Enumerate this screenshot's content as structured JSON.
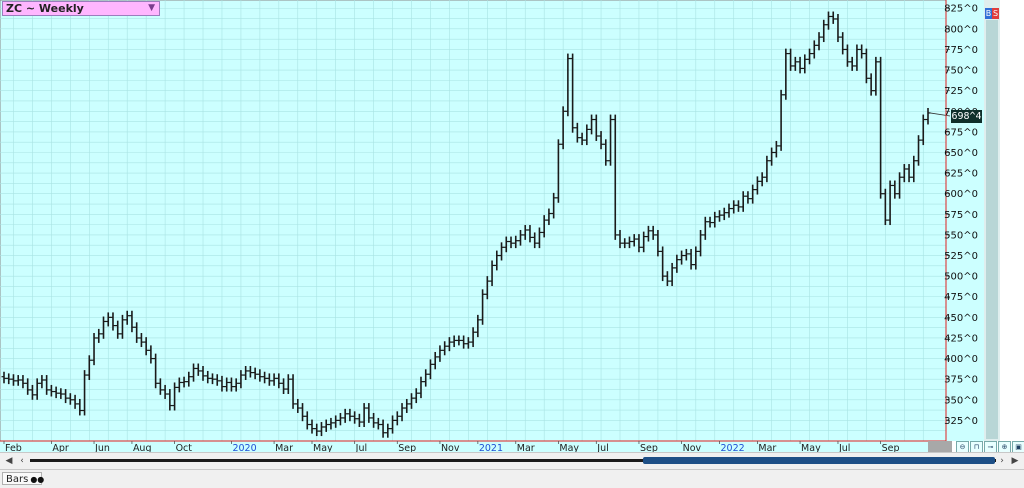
{
  "symbol": {
    "label": "ZC ~ Weekly"
  },
  "side_tags": {
    "buy": "B",
    "sell": "S"
  },
  "last_price_flag": "698^4",
  "status_bar": {
    "tab_label": "Bars"
  },
  "colors": {
    "plot_background": "#ccffff",
    "grid": "#a9e3e3",
    "bars": "#1a1a1a",
    "year_label": "#1f4fd6",
    "axis_line": "#e02020"
  },
  "chart_data": {
    "type": "ohlc",
    "title": "ZC ~ Weekly",
    "ylim": [
      300,
      835
    ],
    "y_ticks": [
      "325^0",
      "350^0",
      "375^0",
      "400^0",
      "425^0",
      "450^0",
      "475^0",
      "500^0",
      "525^0",
      "550^0",
      "575^0",
      "600^0",
      "625^0",
      "650^0",
      "675^0",
      "700^0",
      "725^0",
      "750^0",
      "775^0",
      "800^0",
      "825^0"
    ],
    "y_tick_values": [
      325,
      350,
      375,
      400,
      425,
      450,
      475,
      500,
      525,
      550,
      575,
      600,
      625,
      650,
      675,
      700,
      725,
      750,
      775,
      800,
      825
    ],
    "x_labels": [
      {
        "text": "Feb",
        "week": 0,
        "year": false
      },
      {
        "text": "Apr",
        "week": 10,
        "year": false
      },
      {
        "text": "Jun",
        "week": 19,
        "year": false
      },
      {
        "text": "Aug",
        "week": 27,
        "year": false
      },
      {
        "text": "Oct",
        "week": 36,
        "year": false
      },
      {
        "text": "2020",
        "week": 48,
        "year": true
      },
      {
        "text": "Mar",
        "week": 57,
        "year": false
      },
      {
        "text": "May",
        "week": 65,
        "year": false
      },
      {
        "text": "Jul",
        "week": 74,
        "year": false
      },
      {
        "text": "Sep",
        "week": 83,
        "year": false
      },
      {
        "text": "Nov",
        "week": 92,
        "year": false
      },
      {
        "text": "2021",
        "week": 100,
        "year": true
      },
      {
        "text": "Mar",
        "week": 108,
        "year": false
      },
      {
        "text": "May",
        "week": 117,
        "year": false
      },
      {
        "text": "Jul",
        "week": 125,
        "year": false
      },
      {
        "text": "Sep",
        "week": 134,
        "year": false
      },
      {
        "text": "Nov",
        "week": 143,
        "year": false
      },
      {
        "text": "2022",
        "week": 151,
        "year": true
      },
      {
        "text": "Mar",
        "week": 159,
        "year": false
      },
      {
        "text": "May",
        "week": 168,
        "year": false
      },
      {
        "text": "Jul",
        "week": 176,
        "year": false
      },
      {
        "text": "Sep",
        "week": 185,
        "year": false
      }
    ],
    "x_range_weeks": [
      0,
      188
    ],
    "close": [
      376,
      375,
      373,
      374,
      370,
      362,
      356,
      370,
      374,
      362,
      360,
      358,
      357,
      352,
      350,
      345,
      337,
      380,
      398,
      425,
      430,
      445,
      450,
      440,
      430,
      447,
      452,
      438,
      425,
      420,
      410,
      400,
      370,
      362,
      357,
      343,
      365,
      371,
      372,
      378,
      388,
      385,
      379,
      376,
      375,
      373,
      366,
      371,
      366,
      370,
      380,
      385,
      383,
      381,
      378,
      376,
      373,
      376,
      370,
      363,
      375,
      345,
      340,
      330,
      320,
      315,
      312,
      317,
      320,
      322,
      325,
      328,
      333,
      330,
      327,
      323,
      340,
      328,
      322,
      320,
      310,
      315,
      325,
      330,
      340,
      345,
      352,
      358,
      372,
      381,
      393,
      402,
      410,
      415,
      420,
      422,
      422,
      418,
      420,
      432,
      447,
      478,
      494,
      513,
      525,
      535,
      542,
      540,
      543,
      550,
      556,
      547,
      540,
      553,
      568,
      576,
      595,
      660,
      700,
      764,
      680,
      668,
      665,
      678,
      690,
      670,
      660,
      640,
      690,
      550,
      540,
      540,
      542,
      545,
      535,
      548,
      555,
      550,
      530,
      500,
      494,
      510,
      520,
      525,
      527,
      514,
      530,
      550,
      566,
      565,
      572,
      574,
      577,
      582,
      586,
      584,
      597,
      594,
      605,
      615,
      620,
      640,
      650,
      658,
      720,
      770,
      755,
      760,
      752,
      763,
      770,
      780,
      790,
      805,
      815,
      812,
      790,
      775,
      760,
      755,
      775,
      770,
      740,
      725,
      760,
      600,
      568,
      610,
      600,
      620,
      630,
      620,
      640,
      665,
      690,
      698
    ]
  }
}
